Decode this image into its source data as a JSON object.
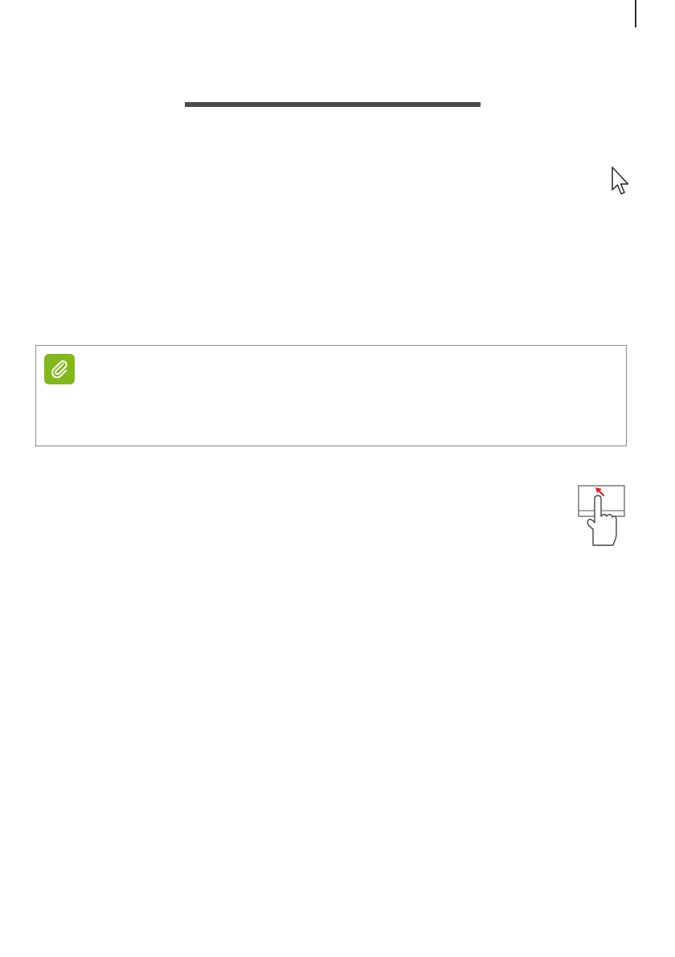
{
  "page": {
    "icons": {
      "pointer": "mouse-pointer-icon",
      "note": "paperclip-note-icon",
      "touchpad": "touchpad-swipe-icon"
    },
    "colors": {
      "note_icon_bg": "#83b81a",
      "swipe_arrow": "#e0202a",
      "rule": "#4a4a4a",
      "note_border": "#8c8c8c"
    }
  }
}
